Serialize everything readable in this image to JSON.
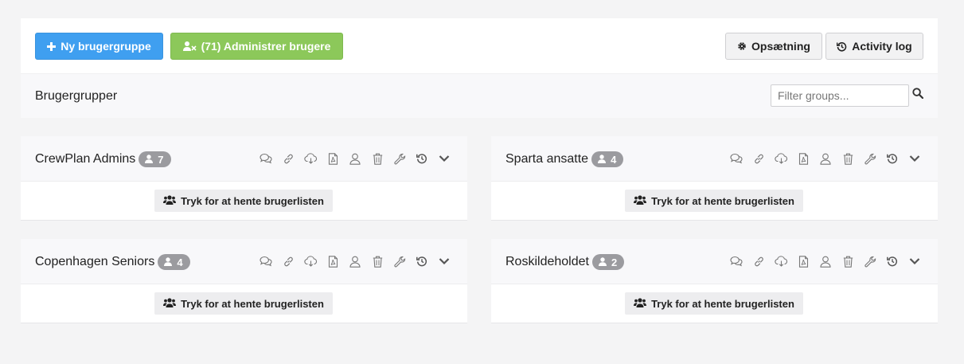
{
  "toolbar": {
    "new_group": "Ny brugergruppe",
    "manage_users": "(71) Administrer brugere",
    "setup": "Opsætning",
    "activity_log": "Activity log"
  },
  "subheader": {
    "title": "Brugergrupper",
    "filter_placeholder": "Filter groups..."
  },
  "groups": [
    {
      "name": "CrewPlan Admins",
      "count": "7",
      "fetch_label": "Tryk for at hente brugerlisten"
    },
    {
      "name": "Sparta ansatte",
      "count": "4",
      "fetch_label": "Tryk for at hente brugerlisten"
    },
    {
      "name": "Copenhagen Seniors",
      "count": "4",
      "fetch_label": "Tryk for at hente brugerlisten"
    },
    {
      "name": "Roskildeholdet",
      "count": "2",
      "fetch_label": "Tryk for at hente brugerlisten"
    }
  ],
  "group_action_icons": [
    "comments-icon",
    "link-icon",
    "cloud-download-icon",
    "pdf-file-icon",
    "user-icon",
    "trash-icon",
    "wrench-icon",
    "history-icon",
    "chevron-down-icon"
  ],
  "colors": {
    "primary": "#3f9ff0",
    "success": "#8cc85a",
    "badge": "#9b9b9f",
    "background": "#f4f4f5"
  }
}
